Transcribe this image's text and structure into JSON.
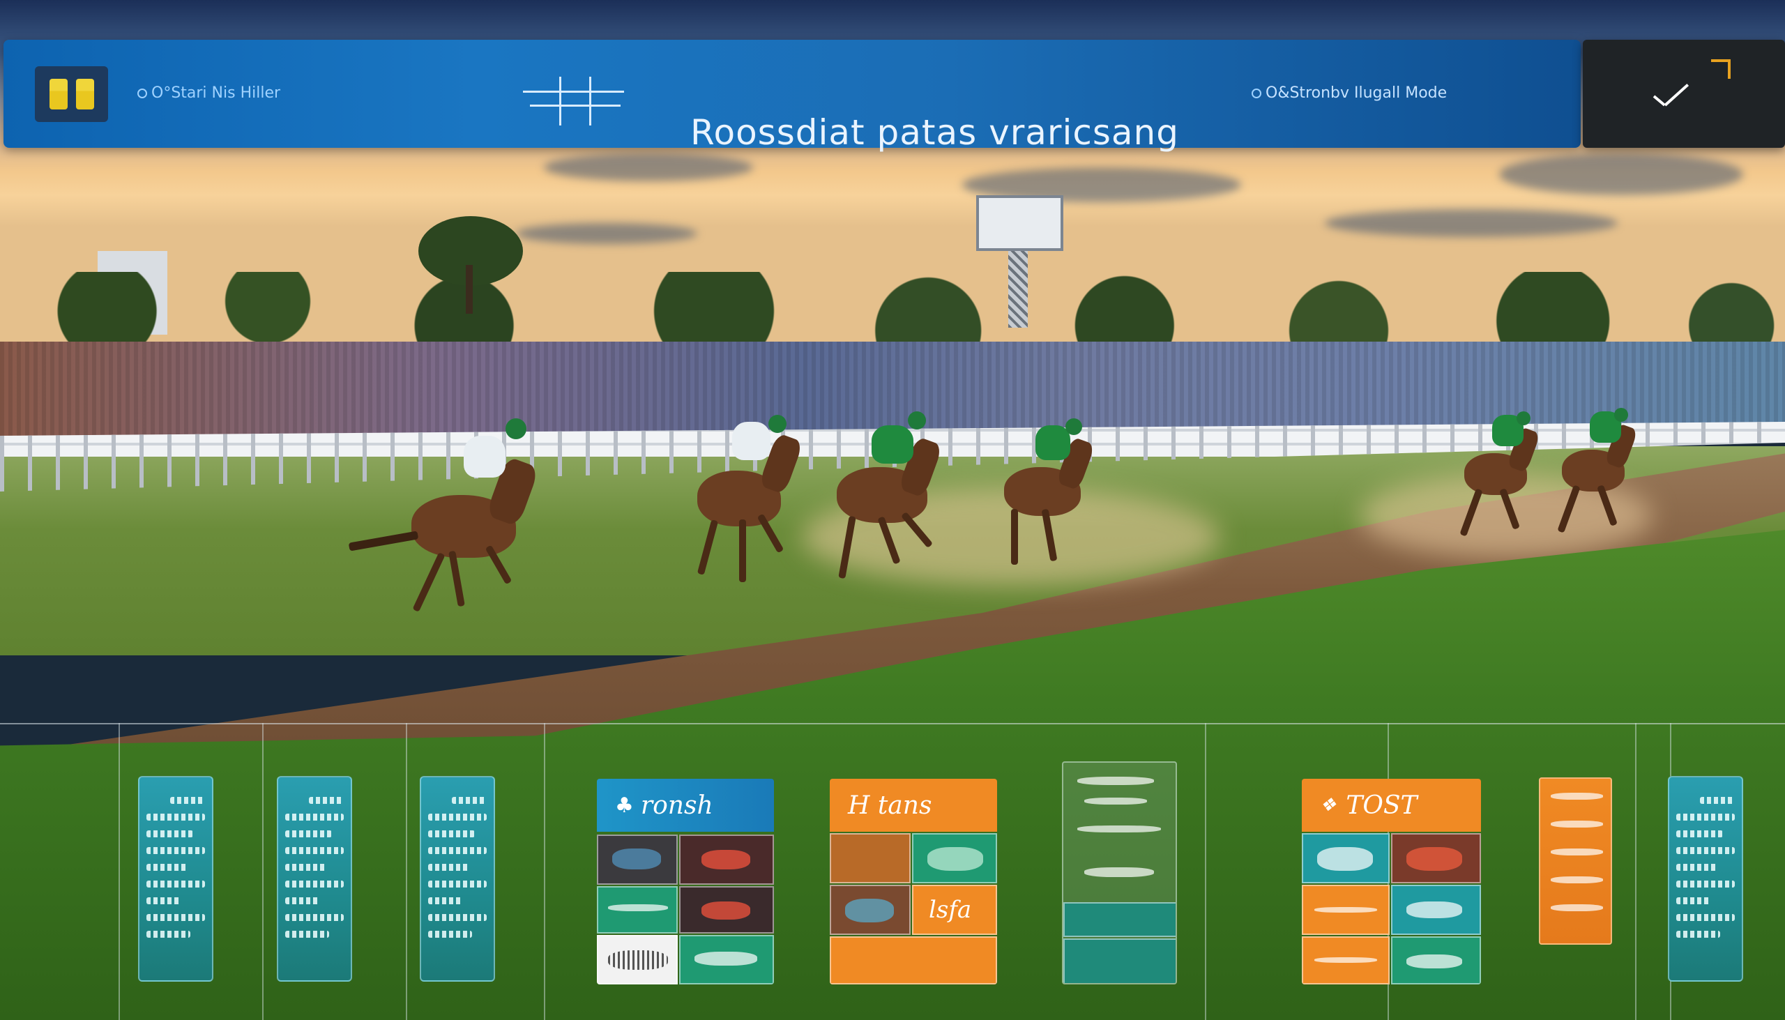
{
  "header": {
    "left_status": "O°Stari Nis Hiller",
    "title": "Roossdiat patas vraricsang",
    "right_status": "O&Stronbv Ilugall Mode"
  },
  "actions": {
    "confirm_icon": "checkmark-icon"
  },
  "panels": {
    "blue": {
      "label": "ronsh"
    },
    "orange": {
      "label": "H tans",
      "cell_label": "lsfa"
    },
    "glass": {
      "label": ""
    },
    "score": {
      "label": "TOST"
    }
  },
  "colors": {
    "header_blue": "#1a76c2",
    "accent_orange": "#f08a24",
    "accent_teal": "#1f9a8a",
    "confirm_dark": "#1f2326"
  }
}
